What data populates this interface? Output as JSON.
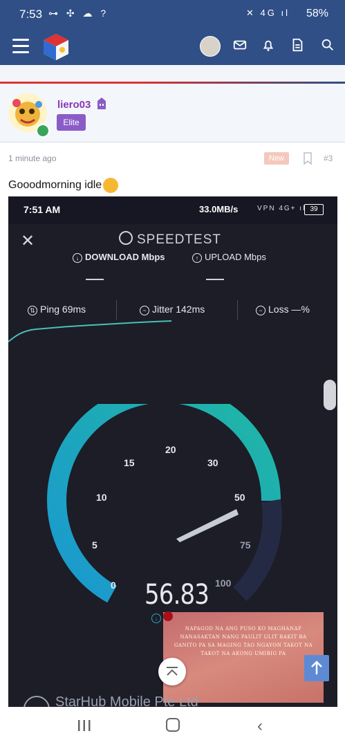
{
  "status_bar": {
    "time": "7:53",
    "left_icons": "⊶ ✣ ☁ ?",
    "right_icons": "✕ 4G ıl",
    "battery": "58%"
  },
  "app_bar": {
    "icons": [
      "menu-icon",
      "site-logo",
      "user-avatar",
      "mail-icon",
      "bell-icon",
      "document-icon",
      "search-icon"
    ]
  },
  "post": {
    "username": "liero03",
    "user_title": "Elite",
    "time_ago": "1 minute ago",
    "new_label": "New",
    "post_number": "#3",
    "text": "Gooodmorning idle"
  },
  "embedded": {
    "time": "7:51 AM",
    "rate": "33.0MB/s",
    "status_icons": "VPN 4G+ ıl",
    "battery": "39",
    "title": "SPEEDTEST",
    "download_label": "DOWNLOAD Mbps",
    "upload_label": "UPLOAD Mbps",
    "ping_label": "Ping 69ms",
    "jitter_label": "Jitter 142ms",
    "loss_label": "Loss —%",
    "speed_value": "56.83",
    "gauge_ticks": [
      "0",
      "5",
      "10",
      "15",
      "20",
      "30",
      "50",
      "75",
      "100"
    ],
    "gauge_fill_value": 56.83,
    "card_text": "NAPAGOD NA ANG PUSO KO MAGHANAP NANASAKTAN NANG PAULIT ULIT BAKIT BA GANITO PA SA MAGING TAO NGAYON TAKOT NA TAKOT NA AKONG UMIBIG PA",
    "carrier": "StarHub Mobile Pte Ltd"
  },
  "colors": {
    "header_bg": "#2f4f86",
    "username": "#8b36b5",
    "elite_badge": "#8b5bc8",
    "gauge_teal": "#20b8a4",
    "gauge_blue": "#1a98d0"
  }
}
